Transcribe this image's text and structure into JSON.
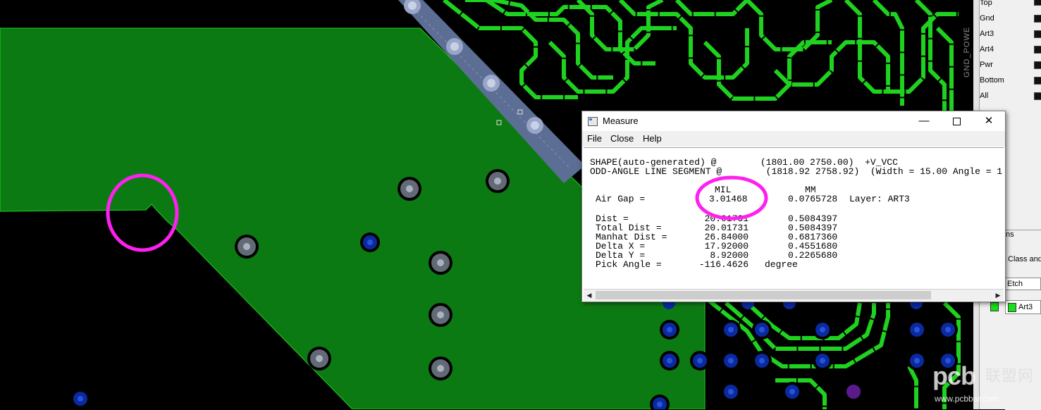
{
  "colors": {
    "board": "#000000",
    "copper_shape": "#0c7a12",
    "trace": "#1fd21f",
    "via_ring": "#7f8896",
    "blue_pad": "#0a2aa0",
    "highlight_circle": "#ff1ff0",
    "silkscreen_band": "#5c6e94"
  },
  "layers_panel": {
    "rows": [
      "Top",
      "Gnd",
      "Art3",
      "Art4",
      "Pwr",
      "Bottom",
      "All"
    ],
    "vertical_label": "GND_POWE"
  },
  "options_panel": {
    "title": "ns",
    "class_text": "Class and",
    "etch_value": "Etch",
    "subclass_value": "Art3"
  },
  "measure_window": {
    "title": "Measure",
    "menu": [
      "File",
      "Close",
      "Help"
    ],
    "lines": {
      "shape": "SHAPE(auto-generated) @        (1801.00 2750.00)  +V_VCC",
      "segment": "ODD-ANGLE LINE SEGMENT @        (1818.92 2758.92)  (Width = 15.00 Angle = 1",
      "header_mil": "MIL",
      "header_mm": "MM",
      "air_gap_label": "Air Gap =",
      "air_gap_mil": "3.01468",
      "air_gap_mm": "0.0765728",
      "air_gap_layer": "Layer: ART3"
    },
    "rows": [
      {
        "label": "Dist =",
        "mil": "20.01731",
        "mm": "0.5084397"
      },
      {
        "label": "Total Dist =",
        "mil": "20.01731",
        "mm": "0.5084397"
      },
      {
        "label": "Manhat Dist =",
        "mil": "26.84000",
        "mm": "0.6817360"
      },
      {
        "label": "Delta X =",
        "mil": "17.92000",
        "mm": "0.4551680"
      },
      {
        "label": "Delta Y =",
        "mil": "8.92000",
        "mm": "0.2265680"
      },
      {
        "label": "Pick Angle =",
        "mil": "-116.4626",
        "mm": "degree"
      }
    ]
  },
  "watermark": {
    "logo": "pcb",
    "cn": "联盟网",
    "url": "www.pcbbar.com"
  }
}
